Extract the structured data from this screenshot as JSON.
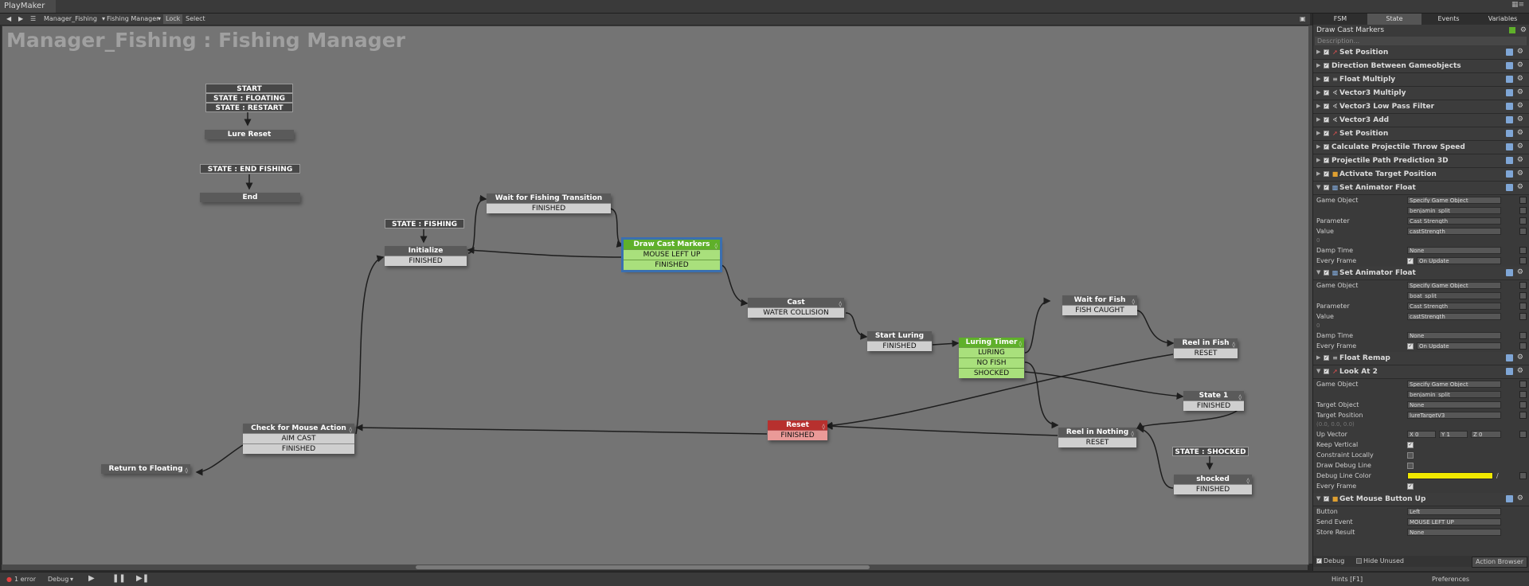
{
  "window": {
    "title": "PlayMaker"
  },
  "toolbar": {
    "fsm_owner": "Manager_Fishing",
    "fsm_name": "Fishing Manager",
    "lock_label": "Lock",
    "select_label": "Select"
  },
  "canvas": {
    "title": "Manager_Fishing : Fishing Manager",
    "globals": [
      "START",
      "STATE : FLOATING",
      "STATE : RESTART",
      "STATE : END FISHING",
      "STATE : FISHING",
      "STATE : SHOCKED"
    ],
    "states": {
      "lure_reset": {
        "name": "Lure Reset"
      },
      "end": {
        "name": "End"
      },
      "initialize": {
        "name": "Initialize",
        "transitions": [
          "FINISHED"
        ]
      },
      "wait_transition": {
        "name": "Wait for Fishing Transition",
        "transitions": [
          "FINISHED"
        ]
      },
      "draw_cast": {
        "name": "Draw Cast Markers",
        "transitions": [
          "MOUSE LEFT UP",
          "FINISHED"
        ]
      },
      "cast": {
        "name": "Cast",
        "transitions": [
          "WATER COLLISION"
        ]
      },
      "start_luring": {
        "name": "Start Luring",
        "transitions": [
          "FINISHED"
        ]
      },
      "luring_timer": {
        "name": "Luring Timer",
        "transitions": [
          "LURING",
          "NO FISH",
          "SHOCKED"
        ]
      },
      "wait_fish": {
        "name": "Wait for Fish",
        "transitions": [
          "FISH CAUGHT"
        ]
      },
      "reel_in_fish": {
        "name": "Reel in Fish",
        "transitions": [
          "RESET"
        ]
      },
      "state1": {
        "name": "State 1",
        "transitions": [
          "FINISHED"
        ]
      },
      "reel_nothing": {
        "name": "Reel in Nothing",
        "transitions": [
          "RESET"
        ]
      },
      "shocked": {
        "name": "shocked",
        "transitions": [
          "FINISHED"
        ]
      },
      "reset": {
        "name": "Reset",
        "transitions": [
          "FINISHED"
        ]
      },
      "check_mouse": {
        "name": "Check for Mouse Action",
        "transitions": [
          "AIM CAST",
          "FINISHED"
        ]
      },
      "return_floating": {
        "name": "Return to Floating"
      }
    }
  },
  "statusbar": {
    "errors": "1 error",
    "debug": "Debug",
    "hints": "Hints [F1]",
    "preferences": "Preferences"
  },
  "panel": {
    "tabs": [
      "FSM",
      "State",
      "Events",
      "Variables"
    ],
    "active_tab": "State",
    "state_name": "Draw Cast Markers",
    "description_placeholder": "Description...",
    "actions": [
      "Set Position",
      "Direction Between Gameobjects",
      "Float Multiply",
      "Vector3 Multiply",
      "Vector3 Low Pass Filter",
      "Vector3 Add",
      "Set Position",
      "Calculate Projectile Throw Speed",
      "Projectile Path Prediction 3D",
      "Activate Target Position",
      "Set Animator Float",
      "Set Animator Float",
      "Float Remap",
      "Look At 2",
      "Get Mouse Button Up"
    ],
    "anim1": {
      "game_object_label": "Game Object",
      "game_object_mode": "Specify Game Object",
      "game_object": "benjamin_split",
      "parameter_label": "Parameter",
      "parameter": "Cast Strength",
      "value_label": "Value",
      "value": "castStrength",
      "value_hint": "0",
      "damp_label": "Damp Time",
      "damp": "None",
      "every_frame_label": "Every Frame",
      "every_frame_mode": "On Update"
    },
    "anim2": {
      "game_object_label": "Game Object",
      "game_object_mode": "Specify Game Object",
      "game_object": "boat_split",
      "parameter_label": "Parameter",
      "parameter": "Cast Strength",
      "value_label": "Value",
      "value": "castStrength",
      "value_hint": "0",
      "damp_label": "Damp Time",
      "damp": "None",
      "every_frame_label": "Every Frame",
      "every_frame_mode": "On Update"
    },
    "lookat": {
      "game_object_label": "Game Object",
      "game_object_mode": "Specify Game Object",
      "game_object": "benjamin_split",
      "target_object_label": "Target Object",
      "target_object": "None",
      "target_position_label": "Target Position",
      "target_position": "lureTargetV3",
      "target_hint": "(0.0, 0.0, 0.0)",
      "up_vector_label": "Up Vector",
      "up_x": "X  0",
      "up_y": "Y  1",
      "up_z": "Z  0",
      "keep_vertical_label": "Keep Vertical",
      "constraint_label": "Constraint Locally",
      "draw_debug_label": "Draw Debug Line",
      "debug_color_label": "Debug Line Color",
      "every_frame_label": "Every Frame"
    },
    "mouse": {
      "button_label": "Button",
      "button": "Left",
      "send_event_label": "Send Event",
      "send_event": "MOUSE LEFT UP",
      "store_result_label": "Store Result",
      "store_result": "None"
    },
    "bottom": {
      "debug": "Debug",
      "hide_unused": "Hide Unused",
      "action_browser": "Action Browser"
    },
    "colors": {
      "accent_green": "#5fb02a",
      "selected_outline": "#3a6fb0",
      "reset_red": "#b7302e",
      "debug_yellow": "#f0e800"
    }
  }
}
